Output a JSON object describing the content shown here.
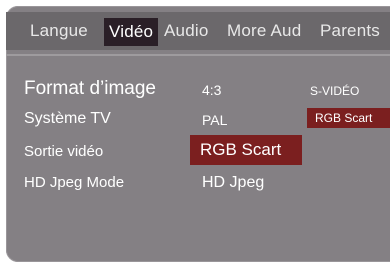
{
  "tabs": [
    {
      "label": "Langue"
    },
    {
      "label": "Vidéo",
      "selected": true
    },
    {
      "label": "Audio"
    },
    {
      "label": "More Aud"
    },
    {
      "label": "Parents"
    }
  ],
  "settings": [
    {
      "label": "Format d’image",
      "value": "4:3"
    },
    {
      "label": "Système TV",
      "value": "PAL"
    },
    {
      "label": "Sortie vidéo",
      "value": "RGB Scart",
      "selected": true
    },
    {
      "label": "HD Jpeg Mode",
      "value": "HD Jpeg"
    }
  ],
  "options": [
    {
      "label": "S-VIDÉO"
    },
    {
      "label": "RGB Scart",
      "highlighted": true
    }
  ],
  "colors": {
    "panel": "#848084",
    "tabbar": "#6b686b",
    "selected_tab": "#2a1f27",
    "highlight": "#7b1f1f",
    "text": "#ffffff"
  }
}
